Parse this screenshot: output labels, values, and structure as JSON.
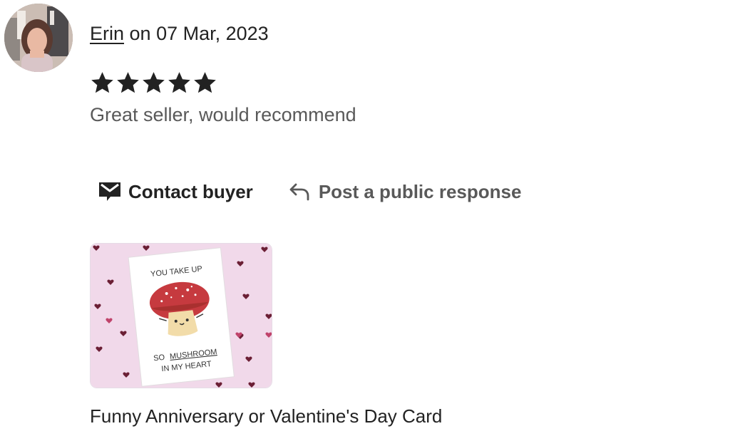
{
  "review": {
    "reviewer_name": "Erin",
    "date_text": "on 07 Mar, 2023",
    "rating": 5,
    "rating_max": 5,
    "text": "Great seller, would recommend"
  },
  "actions": {
    "contact_label": "Contact buyer",
    "contact_icon": "envelope-icon",
    "respond_label": "Post a public response",
    "respond_icon": "reply-arrow-icon"
  },
  "listing": {
    "title": "Funny Anniversary or Valentine's Day Card",
    "card_text_top": "YOU TAKE UP",
    "card_text_so": "SO",
    "card_text_mushroom": "MUSHROOM",
    "card_text_heart": "IN MY HEART"
  },
  "colors": {
    "text_primary": "#222222",
    "text_secondary": "#595959",
    "star": "#222222",
    "card_background": "#f1d9ea",
    "mushroom_cap": "#c63a3f"
  }
}
